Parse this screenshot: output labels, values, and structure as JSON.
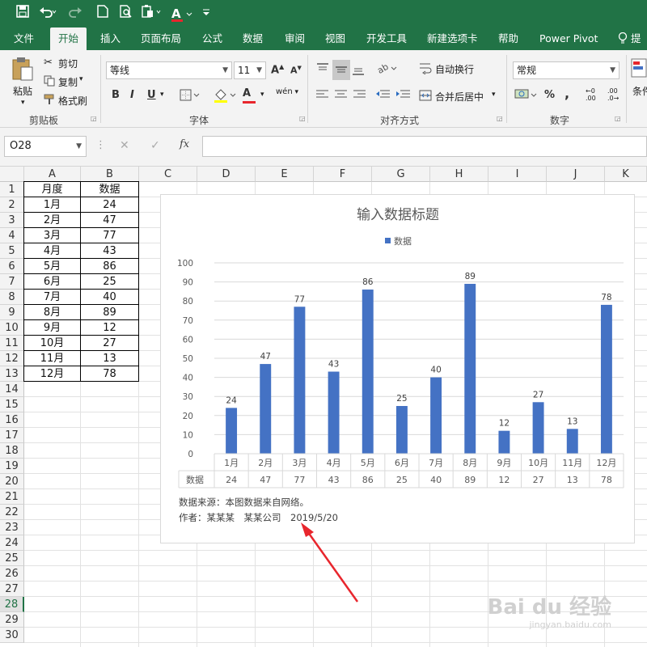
{
  "titlebar": {
    "qat_icons": [
      "save-icon",
      "undo-icon",
      "redo-icon",
      "new-doc-icon",
      "print-preview-icon",
      "paste-icon",
      "font-color-icon",
      "customize-qat-icon"
    ],
    "font_color_glyph": "A"
  },
  "tabs": [
    "文件",
    "开始",
    "插入",
    "页面布局",
    "公式",
    "数据",
    "审阅",
    "视图",
    "开发工具",
    "新建选项卡",
    "帮助",
    "Power Pivot",
    "提"
  ],
  "active_tab": "开始",
  "ribbon": {
    "clipboard": {
      "paste": "粘贴",
      "cut": "剪切",
      "copy": "复制",
      "format_painter": "格式刷",
      "label": "剪贴板"
    },
    "font": {
      "name": "等线",
      "size": "11",
      "grow": "A",
      "shrink": "A",
      "bold": "B",
      "italic": "I",
      "underline": "U",
      "font_color": "A",
      "phonetic": "wén",
      "label": "字体"
    },
    "alignment": {
      "wrap": "自动换行",
      "merge": "合并后居中",
      "label": "对齐方式"
    },
    "number": {
      "format": "常规",
      "percent": "%",
      "comma": ",",
      "inc_dec": ".00",
      "dec_dec": ".0",
      "label": "数字"
    },
    "styles": {
      "label": "条件"
    }
  },
  "formula_bar": {
    "name_box": "O28",
    "cancel": "✕",
    "enter": "✓",
    "fx": "fx",
    "formula": ""
  },
  "columns": [
    "A",
    "B",
    "C",
    "D",
    "E",
    "F",
    "G",
    "H",
    "I",
    "J",
    "K"
  ],
  "rows": [
    "1",
    "2",
    "3",
    "4",
    "5",
    "6",
    "7",
    "8",
    "9",
    "10",
    "11",
    "12",
    "13",
    "14",
    "15",
    "16",
    "17",
    "18",
    "19",
    "20",
    "21",
    "22",
    "23",
    "24",
    "25",
    "26",
    "27",
    "28",
    "29",
    "30"
  ],
  "selected_row": "28",
  "table": {
    "headers": [
      "月度",
      "数据"
    ],
    "rows": [
      [
        "1月",
        "24"
      ],
      [
        "2月",
        "47"
      ],
      [
        "3月",
        "77"
      ],
      [
        "4月",
        "43"
      ],
      [
        "5月",
        "86"
      ],
      [
        "6月",
        "25"
      ],
      [
        "7月",
        "40"
      ],
      [
        "8月",
        "89"
      ],
      [
        "9月",
        "12"
      ],
      [
        "10月",
        "27"
      ],
      [
        "11月",
        "13"
      ],
      [
        "12月",
        "78"
      ]
    ]
  },
  "chart_data": {
    "type": "bar",
    "title": "输入数据标题",
    "legend": "top",
    "categories": [
      "1月",
      "2月",
      "3月",
      "4月",
      "5月",
      "6月",
      "7月",
      "8月",
      "9月",
      "10月",
      "11月",
      "12月"
    ],
    "series": [
      {
        "name": "数据",
        "values": [
          24,
          47,
          77,
          43,
          86,
          25,
          40,
          89,
          12,
          27,
          13,
          78
        ],
        "color": "#4472c4"
      }
    ],
    "ylim": [
      0,
      100
    ],
    "yticks": [
      0,
      10,
      20,
      30,
      40,
      50,
      60,
      70,
      80,
      90,
      100
    ],
    "grid": true,
    "data_table": true,
    "data_labels": true
  },
  "chart_notes": {
    "source": "数据来源：本图数据来自网络。",
    "author": "作者：某某某　某某公司　2019/5/20"
  },
  "watermark": {
    "brand": "Bai du 经验",
    "url": "jingyan.baidu.com"
  },
  "colors": {
    "excel_green": "#217346",
    "bar_blue": "#4472c4",
    "arrow_red": "#e8262d"
  }
}
